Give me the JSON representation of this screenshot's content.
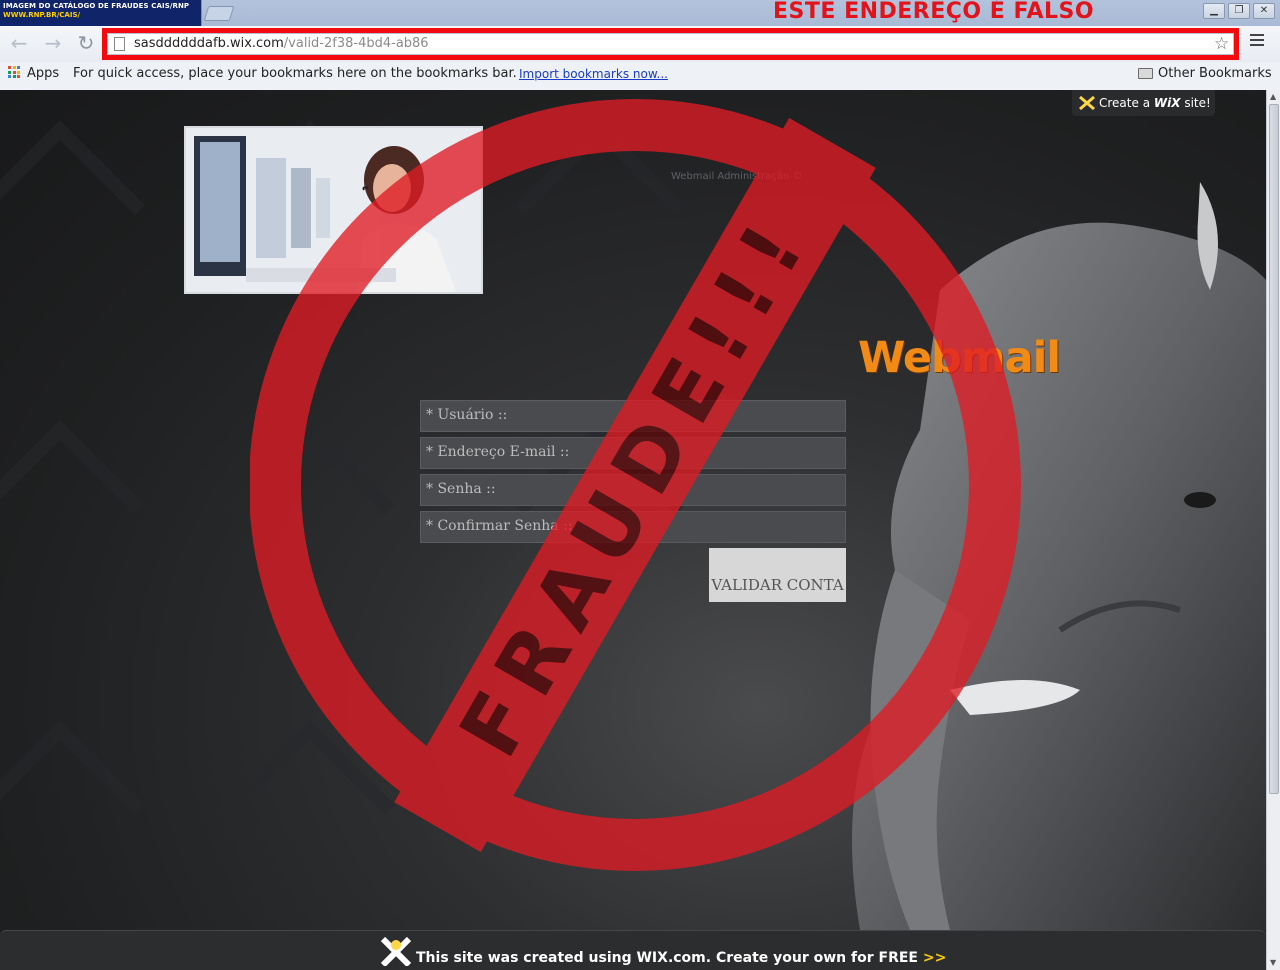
{
  "tab": {
    "caption_line1": "IMAGEM DO CATÁLOGO DE FRAUDES CAIS/RNP",
    "caption_line2": "WWW.RNP.BR/CAIS/"
  },
  "warning_banner": "ESTE ENDEREÇO É FALSO",
  "window_controls": {
    "minimize": "▁",
    "restore": "❐",
    "close": "✕"
  },
  "address_bar": {
    "url_host": "sasddddddafb.wix.com",
    "url_path": "/valid-2f38-4bd4-ab86"
  },
  "bookmarks_bar": {
    "apps_label": "Apps",
    "hint": "For quick access, place your bookmarks here on the bookmarks bar.",
    "import_link": "Import bookmarks now...",
    "other_label": "Other Bookmarks"
  },
  "wix_create": {
    "prefix": "Create a",
    "brand": "WiX",
    "suffix": "site!"
  },
  "admin_caption": "Webmail Administração ©",
  "logo_text": "Webmail",
  "form": {
    "username_placeholder": "* Usuário ::",
    "email_placeholder": "* Endereço E-mail ::",
    "password_placeholder": "* Senha ::",
    "confirm_placeholder": "* Confirmar Senha ::",
    "submit_label": "VALIDAR CONTA"
  },
  "fraud_stamp": "FRAUDE!!!",
  "footer": {
    "text": "This site was created using WIX.com. Create your own for FREE",
    "arrows": ">>"
  },
  "colors": {
    "warning_red": "#e1131b",
    "stamp_red": "#e01b24",
    "logo_orange": "#f28a16",
    "tab_blue": "#10246a"
  }
}
